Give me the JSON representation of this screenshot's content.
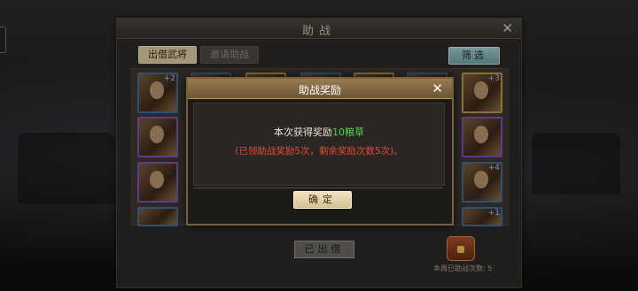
{
  "main_dialog": {
    "title": "助战",
    "tabs": [
      {
        "label": "出借武将",
        "active": true
      },
      {
        "label": "邀请助战",
        "active": false
      }
    ],
    "filter_label": "筛选",
    "lent_label": "已出借",
    "weekly_label": "本周已助战次数: 5",
    "close_icon": "close-icon"
  },
  "reward_popup": {
    "title": "助战奖励",
    "line1_prefix": "本次获得奖励",
    "line1_reward": "10粮草",
    "line2": "(已领助战奖励5次，剩余奖励次数5次)。",
    "confirm_label": "确定",
    "close_icon": "close-icon"
  },
  "colors": {
    "reward_highlight": "#4cd84c",
    "warning": "#e34b3a",
    "popup_header": "#9a7b50",
    "filter_button": "#8fbfc2"
  }
}
